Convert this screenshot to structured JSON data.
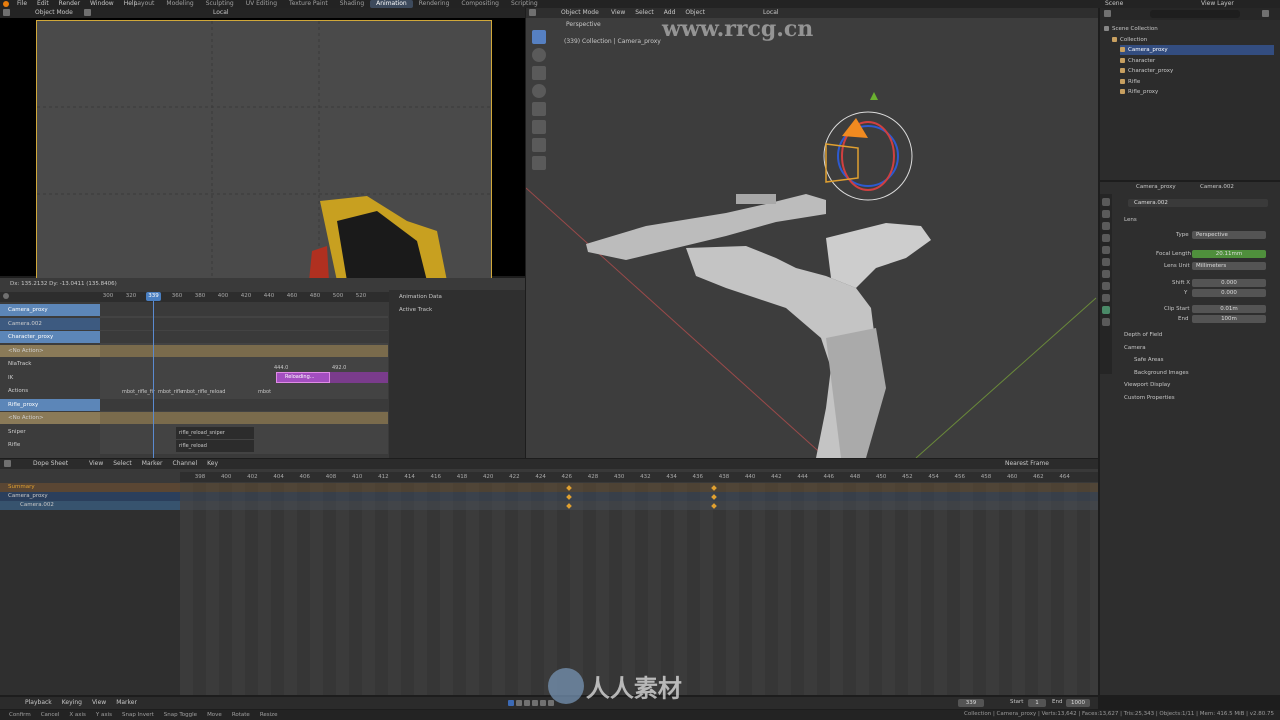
{
  "topbar": {
    "menus": [
      "File",
      "Edit",
      "Render",
      "Window",
      "Help"
    ],
    "workspaces": [
      "Layout",
      "Modeling",
      "Sculpting",
      "UV Editing",
      "Texture Paint",
      "Shading",
      "Animation",
      "Rendering",
      "Compositing",
      "Scripting"
    ],
    "active_workspace": "Animation",
    "scene_label": "Scene",
    "view_layer_label": "View Layer"
  },
  "camera_view": {
    "mode": "Object Mode",
    "orientation": "Local"
  },
  "viewport": {
    "mode": "Object Mode",
    "menus": [
      "View",
      "Select",
      "Add",
      "Object"
    ],
    "orientation": "Local",
    "perspective_label": "Perspective",
    "collection_label": "(339) Collection | Camera_proxy",
    "watermark": "www.rrcg.cn"
  },
  "nla": {
    "cursor_info": "Dx: 135.2132  Dy: -13.0411 (135.8406)",
    "current_frame": "339",
    "ruler": [
      "300",
      "320",
      "339",
      "360",
      "380",
      "400",
      "420",
      "440",
      "460",
      "480",
      "500",
      "520"
    ],
    "channels": [
      {
        "label": "Camera_proxy",
        "type": "object"
      },
      {
        "label": "Camera.002",
        "type": "dim"
      },
      {
        "label": "Character_proxy",
        "type": "object"
      },
      {
        "label": "<No Action>",
        "type": "noaction"
      },
      {
        "label": "NlaTrack",
        "type": "track"
      },
      {
        "label": "IK",
        "type": "track"
      },
      {
        "label": "Actions",
        "type": "track"
      },
      {
        "label": "Rifle_proxy",
        "type": "object"
      },
      {
        "label": "<No Action>",
        "type": "noaction"
      },
      {
        "label": "Sniper",
        "type": "track"
      },
      {
        "label": "Rifle",
        "type": "track"
      }
    ],
    "strips": {
      "strip_start": "444.0",
      "strip_end": "492.0",
      "strip_name": "Reloading...",
      "actions_1": "mbot_rifle_fir",
      "actions_2": "mbot_rifle",
      "actions_3": "mbot_rifle_reload",
      "actions_4": "mbot",
      "sniper": "rifle_reload_sniper",
      "rifle": "rifle_reload"
    },
    "side_tabs": [
      "Animation Data",
      "Active Track"
    ]
  },
  "dopesheet": {
    "editor": "Dope Sheet",
    "menus": [
      "View",
      "Select",
      "Marker",
      "Channel",
      "Key"
    ],
    "snap": "Nearest Frame",
    "ruler": [
      "398",
      "400",
      "402",
      "404",
      "406",
      "408",
      "410",
      "412",
      "414",
      "416",
      "418",
      "420",
      "422",
      "424",
      "426",
      "428",
      "430",
      "432",
      "434",
      "436",
      "438",
      "440",
      "442",
      "444",
      "446",
      "448",
      "450",
      "452",
      "454",
      "456",
      "458",
      "460",
      "462",
      "464"
    ],
    "channels": [
      "Summary",
      "Camera_proxy",
      "Camera.002"
    ]
  },
  "outliner": {
    "items": [
      {
        "label": "Scene Collection",
        "indent": 0
      },
      {
        "label": "Collection",
        "indent": 1
      },
      {
        "label": "Camera_proxy",
        "indent": 2,
        "selected": true
      },
      {
        "label": "Character",
        "indent": 2
      },
      {
        "label": "Character_proxy",
        "indent": 2
      },
      {
        "label": "Rifle",
        "indent": 2
      },
      {
        "label": "Rifle_proxy",
        "indent": 2
      }
    ]
  },
  "properties": {
    "breadcrumb_object": "Camera_proxy",
    "breadcrumb_data": "Camera.002",
    "data_name": "Camera.002",
    "lens_panel": "Lens",
    "type_label": "Type",
    "type_value": "Perspective",
    "focal_label": "Focal Length",
    "focal_value": "20.11mm",
    "lens_unit_label": "Lens Unit",
    "lens_unit_value": "Millimeters",
    "shift_x_label": "Shift X",
    "shift_x_value": "0.000",
    "shift_y_label": "Y",
    "shift_y_value": "0.000",
    "clip_start_label": "Clip Start",
    "clip_start_value": "0.01m",
    "clip_end_label": "End",
    "clip_end_value": "100m",
    "panels": [
      "Depth of Field",
      "Camera",
      "Safe Areas",
      "Background Images",
      "Viewport Display",
      "Custom Properties"
    ]
  },
  "timeline": {
    "menus": [
      "Playback",
      "Keying",
      "View",
      "Marker"
    ],
    "current_frame": "339",
    "start_label": "Start",
    "start_value": "1",
    "end_label": "End",
    "end_value": "1000"
  },
  "statusbar": {
    "hints": [
      "Confirm",
      "Cancel",
      "X axis",
      "Y axis",
      "Snap Invert",
      "Snap Toggle",
      "Move",
      "Rotate",
      "Resize"
    ],
    "stats": "Collection | Camera_proxy | Verts:13,642 | Faces:13,627 | Tris:25,343 | Objects:1/11 | Mem: 416.5 MiB | v2.80.75"
  },
  "watermark_cn": "人人素材",
  "colors": {
    "accent": "#4a7fc1",
    "active_strip": "#a34ec0",
    "focal_field": "#4f8f3c",
    "keyframe": "#e0a030",
    "object_row": "#5c86b8",
    "noaction_row": "#8a7a58"
  }
}
